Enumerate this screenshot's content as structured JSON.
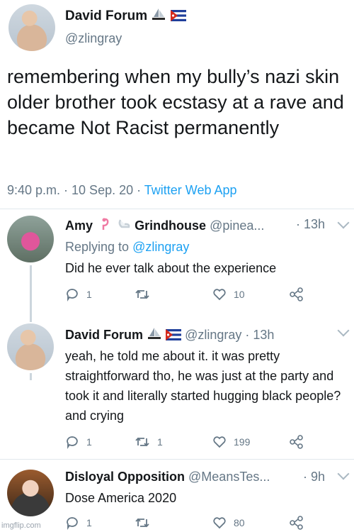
{
  "main_tweet": {
    "author_name": "David Forum",
    "handle": "@zlingray",
    "text": "remembering when my bully’s nazi skin older brother took ecstasy at a rave and became Not Racist permanently",
    "meta": "9:40 p.m. · 10 Sep. 20 · ",
    "client": "Twitter Web App"
  },
  "replies": [
    {
      "name_part1": "Amy",
      "name_part2": "Grindhouse",
      "handle": "@pinea...",
      "time": "· 13h",
      "replying_label": "Replying to ",
      "replying_handle": "@zlingray",
      "text": "Did he ever talk about the experience",
      "reply_count": "1",
      "retweet_count": "",
      "like_count": "10"
    },
    {
      "name": "David Forum",
      "handle": "@zlingray",
      "time": "· 13h",
      "text": "yeah, he told me about it. it was pretty straightforward tho, he was just at the party and took it and literally started hugging black people? and crying",
      "reply_count": "1",
      "retweet_count": "1",
      "like_count": "199"
    },
    {
      "name": "Disloyal Opposition",
      "handle": "@MeansTes...",
      "time": "· 9h",
      "text": "Dose America 2020",
      "reply_count": "1",
      "retweet_count": "",
      "like_count": "80"
    }
  ],
  "watermark": "imgflip.com",
  "colors": {
    "link": "#1da1f2",
    "secondary": "#657786",
    "divider": "#e1e8ed",
    "thread": "#ccd6dd"
  }
}
